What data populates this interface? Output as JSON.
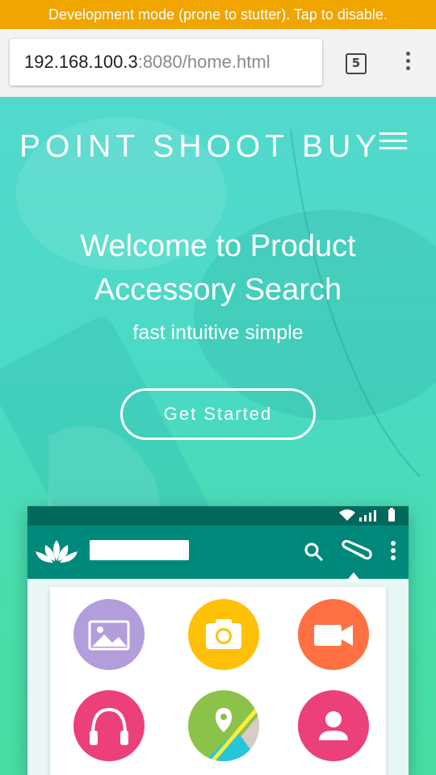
{
  "dev_banner": "Development mode (prone to stutter). Tap to disable.",
  "browser": {
    "url_host": "192.168.100.3",
    "url_rest": ":8080/home.html",
    "tab_count": "5"
  },
  "hero": {
    "brand": "POINT SHOOT BUY",
    "welcome_line1": "Welcome to Product",
    "welcome_line2": "Accessory Search",
    "tagline": "fast intuitive simple",
    "cta_label": "Get Started"
  },
  "colors": {
    "banner": "#f0a500",
    "teal_dark": "#00695c",
    "teal": "#00897b",
    "gallery": "#b39ddb",
    "camera": "#ffc107",
    "video": "#ff7043",
    "audio": "#ec407a",
    "location": "#8bc34a",
    "contact": "#ec407a"
  },
  "phone_mock": {
    "icons": [
      "lotus-logo-icon",
      "search-icon",
      "paperclip-icon",
      "more-vert-icon",
      "wifi-icon",
      "signal-icon",
      "battery-icon"
    ],
    "apps": [
      "gallery-icon",
      "camera-icon",
      "video-icon",
      "headphones-icon",
      "location-icon",
      "contact-icon"
    ]
  }
}
